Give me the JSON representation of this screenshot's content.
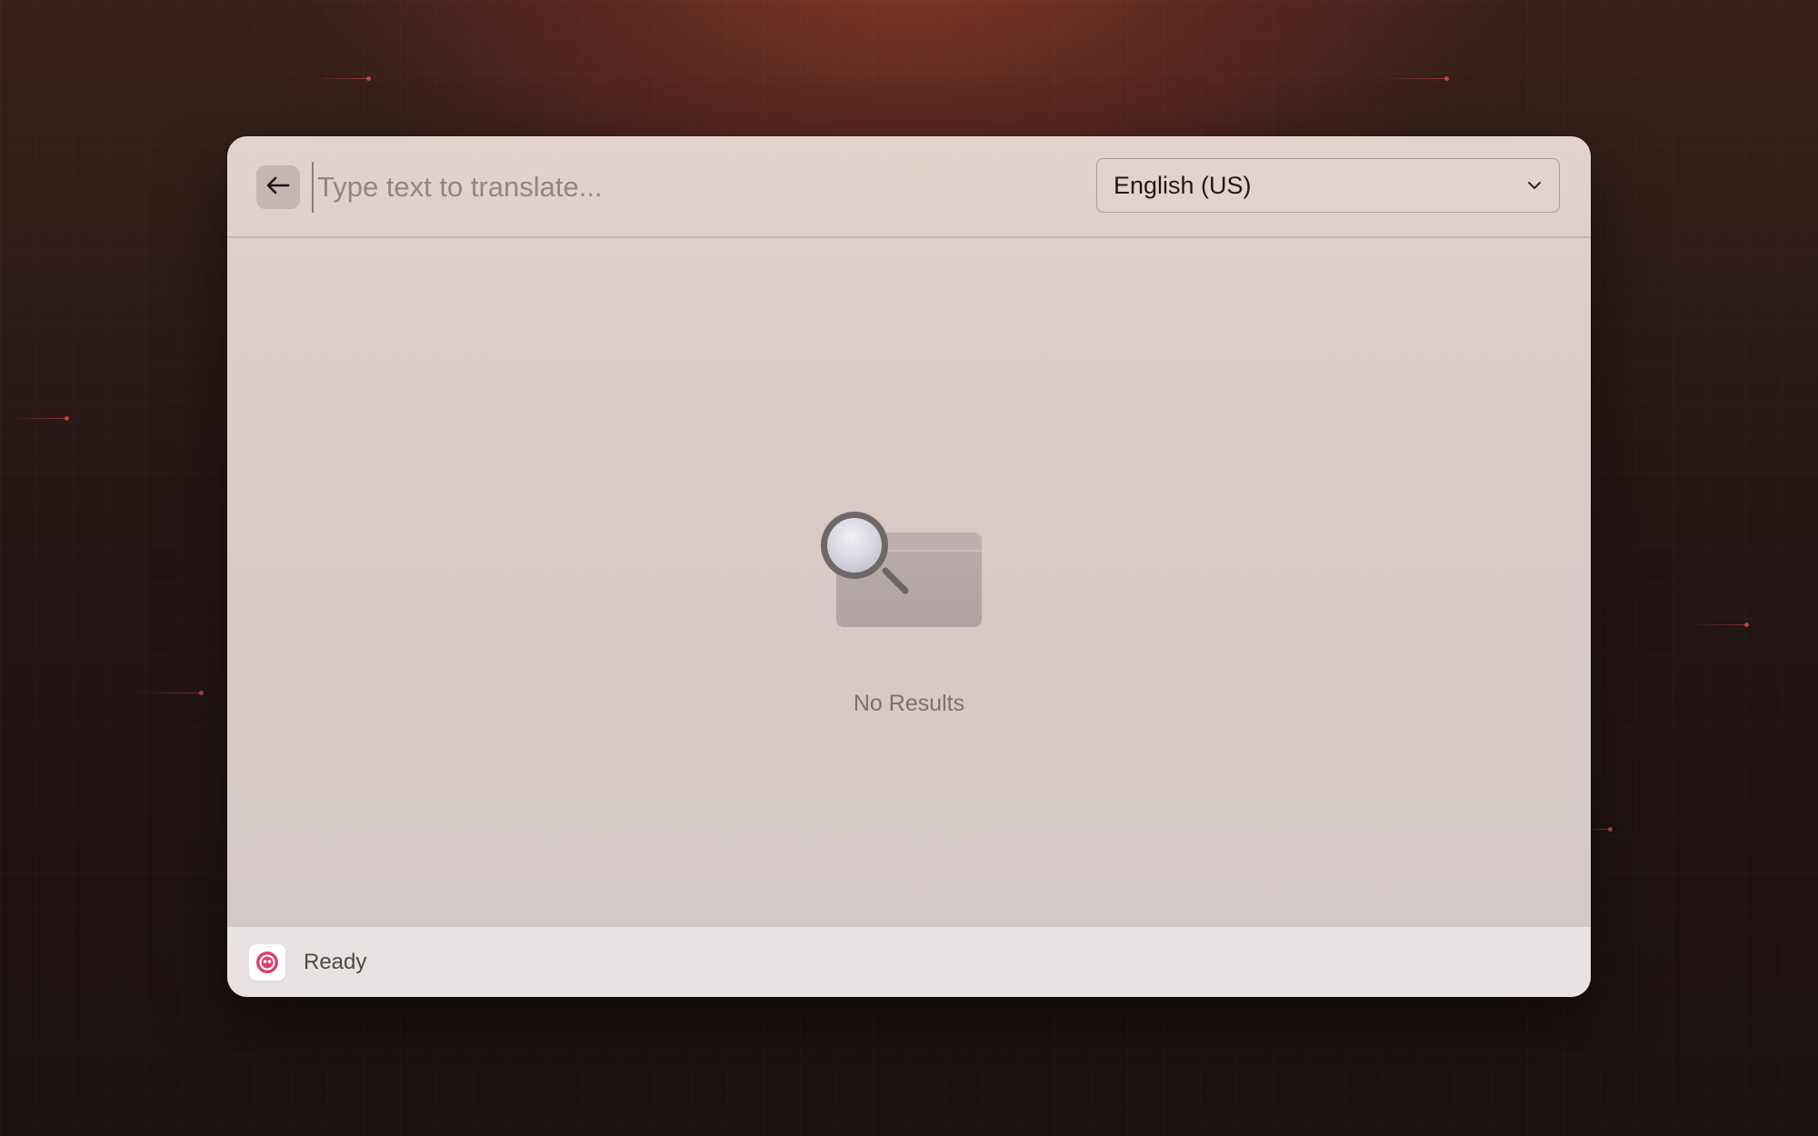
{
  "search": {
    "placeholder": "Type text to translate...",
    "value": ""
  },
  "language_select": {
    "selected": "English (US)"
  },
  "empty_state": {
    "message": "No Results"
  },
  "status_bar": {
    "status": "Ready"
  },
  "icons": {
    "back": "arrow-left-icon",
    "dropdown": "chevron-down-icon",
    "empty": "magnifier-empty-icon",
    "app": "app-logo-icon"
  },
  "colors": {
    "app_icon_accent": "#d2466e"
  }
}
